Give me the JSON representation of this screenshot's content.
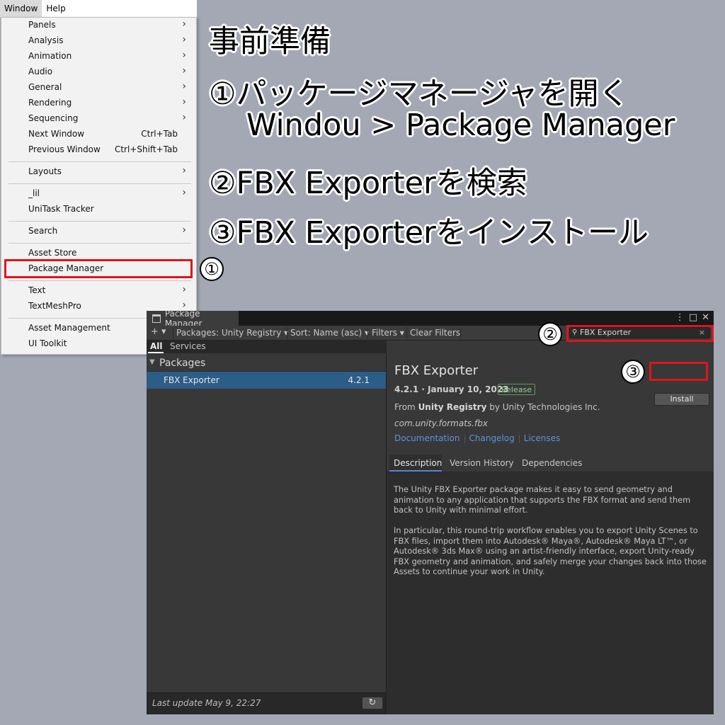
{
  "menubar": {
    "window": "Window",
    "help": "Help"
  },
  "menu": {
    "items": [
      {
        "label": "Panels",
        "submenu": true
      },
      {
        "label": "Analysis",
        "submenu": true
      },
      {
        "label": "Animation",
        "submenu": true
      },
      {
        "label": "Audio",
        "submenu": true
      },
      {
        "label": "General",
        "submenu": true
      },
      {
        "label": "Rendering",
        "submenu": true
      },
      {
        "label": "Sequencing",
        "submenu": true
      },
      {
        "label": "Next Window",
        "shortcut": "Ctrl+Tab"
      },
      {
        "label": "Previous Window",
        "shortcut": "Ctrl+Shift+Tab"
      },
      {
        "label": "Layouts",
        "submenu": true
      },
      {
        "label": "_lil",
        "submenu": true
      },
      {
        "label": "UniTask Tracker"
      },
      {
        "label": "Search",
        "submenu": true
      },
      {
        "label": "Asset Store"
      },
      {
        "label": "Package Manager"
      },
      {
        "label": "Text",
        "submenu": true
      },
      {
        "label": "TextMeshPro",
        "submenu": true
      },
      {
        "label": "Asset Management",
        "submenu": true
      },
      {
        "label": "UI Toolkit",
        "submenu": true
      }
    ],
    "arrow": "›"
  },
  "markers": {
    "one": "①",
    "two": "②",
    "three": "③"
  },
  "instructions": {
    "title": "事前準備",
    "step1": "①パッケージマネージャを開く",
    "step1_path": "Windou > Package Manager",
    "step2": "②FBX Exporterを検索",
    "step3": "③FBX Exporterをインストール"
  },
  "package_manager": {
    "tab_title": "Package Manager",
    "toolbar": {
      "add": "+ ▾",
      "scope": "Packages: Unity Registry ▾",
      "sort": "Sort: Name (asc) ▾",
      "filters": "Filters ▾",
      "clear_filters": "Clear Filters",
      "search_value": "FBX Exporter",
      "clear": "×"
    },
    "subtabs": {
      "all": "All",
      "services": "Services"
    },
    "list": {
      "header": "Packages",
      "items": [
        {
          "name": "FBX Exporter",
          "version": "4.2.1"
        }
      ]
    },
    "footer": {
      "last_update": "Last update May 9, 22:27",
      "refresh": "↻"
    },
    "details": {
      "name": "FBX Exporter",
      "version_date": "4.2.1 · January 10, 2023",
      "badge": "Release",
      "from_prefix": "From",
      "registry": "Unity Registry",
      "from_suffix": "by Unity Technologies Inc.",
      "package_id": "com.unity.formats.fbx",
      "links": [
        "Documentation",
        "Changelog",
        "Licenses"
      ],
      "install": "Install",
      "tabs": [
        "Description",
        "Version History",
        "Dependencies"
      ],
      "description_1": "The Unity FBX Exporter package makes it easy to send geometry and animation to any application that supports the FBX format and send them back to Unity with minimal effort.",
      "description_2": "In particular, this round-trip workflow enables you to export Unity Scenes to FBX files, import them into Autodesk® Maya®, Autodesk® Maya LT™, or Autodesk® 3ds Max® using an artist-friendly interface, export Unity-ready FBX geometry and animation, and safely merge your changes back into those Assets to continue your work in Unity."
    }
  },
  "colors": {
    "highlight": "#e0141b",
    "selection": "#2c5d87",
    "link": "#5d93e0"
  }
}
